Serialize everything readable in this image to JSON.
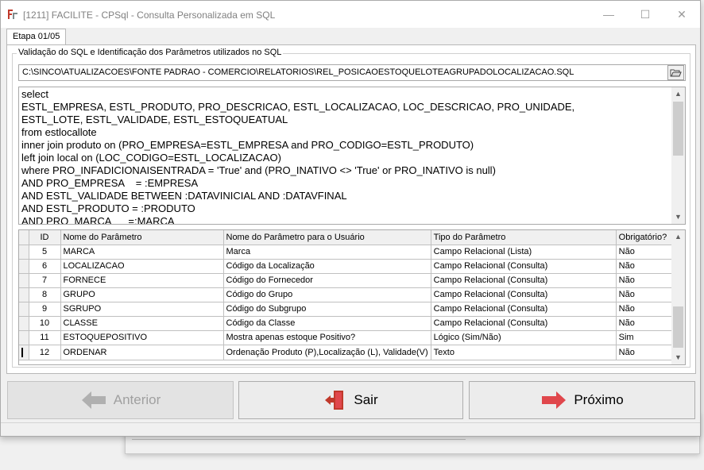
{
  "window": {
    "title": "[1211] FACILITE - CPSql - Consulta Personalizada em SQL",
    "minimize": "—",
    "maximize": "☐",
    "close": "✕"
  },
  "tab": {
    "label": "Etapa 01/05"
  },
  "group": {
    "label": "Validação do SQL e Identificação dos Parâmetros utilizados no SQL"
  },
  "path": {
    "value": "C:\\SINCO\\ATUALIZACOES\\FONTE PADRAO - COMERCIO\\RELATORIOS\\REL_POSICAOESTOQUELOTEAGRUPADOLOCALIZACAO.SQL"
  },
  "sql": {
    "lines": [
      "select",
      "ESTL_EMPRESA, ESTL_PRODUTO, PRO_DESCRICAO, ESTL_LOCALIZACAO, LOC_DESCRICAO, PRO_UNIDADE,",
      "ESTL_LOTE, ESTL_VALIDADE, ESTL_ESTOQUEATUAL",
      "from estlocallote",
      "inner join produto on (PRO_EMPRESA=ESTL_EMPRESA and PRO_CODIGO=ESTL_PRODUTO)",
      "left join local on (LOC_CODIGO=ESTL_LOCALIZACAO)",
      "where PRO_INFADICIONAISENTRADA = 'True' and (PRO_INATIVO <> 'True' or PRO_INATIVO is null)",
      "AND PRO_EMPRESA    = :EMPRESA",
      "AND ESTL_VALIDADE BETWEEN :DATAVINICIAL AND :DATAVFINAL",
      "AND ESTL_PRODUTO = :PRODUTO",
      "AND PRO_MARCA      =:MARCA"
    ]
  },
  "grid": {
    "columns": [
      "ID",
      "Nome do Parâmetro",
      "Nome do Parâmetro para o Usuário",
      "Tipo do Parâmetro",
      "Obrigatório?"
    ],
    "rows": [
      {
        "id": "5",
        "nome": "MARCA",
        "usuario": "Marca",
        "tipo": "Campo Relacional (Lista)",
        "obrig": "Não"
      },
      {
        "id": "6",
        "nome": "LOCALIZACAO",
        "usuario": "Código da Localização",
        "tipo": "Campo Relacional (Consulta)",
        "obrig": "Não"
      },
      {
        "id": "7",
        "nome": "FORNECE",
        "usuario": "Código do Fornecedor",
        "tipo": "Campo Relacional (Consulta)",
        "obrig": "Não"
      },
      {
        "id": "8",
        "nome": "GRUPO",
        "usuario": "Código do Grupo",
        "tipo": "Campo Relacional (Consulta)",
        "obrig": "Não"
      },
      {
        "id": "9",
        "nome": "SGRUPO",
        "usuario": "Código do Subgrupo",
        "tipo": "Campo Relacional (Consulta)",
        "obrig": "Não"
      },
      {
        "id": "10",
        "nome": "CLASSE",
        "usuario": "Código da Classe",
        "tipo": "Campo Relacional (Consulta)",
        "obrig": "Não"
      },
      {
        "id": "11",
        "nome": "ESTOQUEPOSITIVO",
        "usuario": "Mostra apenas estoque Positivo?",
        "tipo": "Lógico (Sim/Não)",
        "obrig": "Sim"
      },
      {
        "id": "12",
        "nome": "ORDENAR",
        "usuario": "Ordenação Produto (P),Localização (L), Validade(V)",
        "tipo": "Texto",
        "obrig": "Não"
      }
    ]
  },
  "buttons": {
    "anterior": "Anterior",
    "sair": "Sair",
    "proximo": "Próximo"
  },
  "colors": {
    "accent_red": "#e0474c",
    "disabled_gray": "#b0b0b0"
  }
}
